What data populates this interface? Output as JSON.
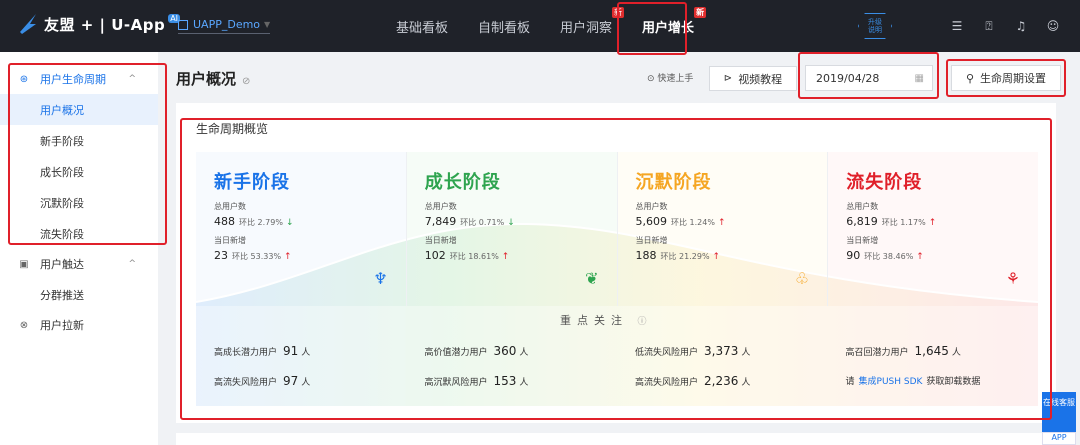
{
  "brand": {
    "name": "友盟 + | U-App",
    "badge": "AI"
  },
  "app_selector": {
    "value": "UAPP_Demo"
  },
  "nav": {
    "items": [
      {
        "label": "基础看板",
        "badge": ""
      },
      {
        "label": "自制看板",
        "badge": ""
      },
      {
        "label": "用户洞察",
        "badge": "新"
      },
      {
        "label": "用户增长",
        "badge": "新"
      }
    ]
  },
  "upgrade": {
    "line1": "升级",
    "line2": "说明"
  },
  "sidebar": {
    "group1": {
      "label": "用户生命周期",
      "icon": "lifecycle-icon"
    },
    "group1_items": [
      {
        "label": "用户概况"
      },
      {
        "label": "新手阶段"
      },
      {
        "label": "成长阶段"
      },
      {
        "label": "沉默阶段"
      },
      {
        "label": "流失阶段"
      }
    ],
    "group2": {
      "label": "用户触达",
      "icon": "reach-icon"
    },
    "group2_items": [
      {
        "label": "分群推送"
      }
    ],
    "group3": {
      "label": "用户拉新",
      "icon": "acquire-icon"
    }
  },
  "header": {
    "title": "用户概况",
    "quick_start": "快速上手",
    "video_btn": "视频教程",
    "date": "2019/04/28",
    "lifecycle_btn": "生命周期设置"
  },
  "panel": {
    "title": "生命周期概览",
    "focus_label": "重点关注",
    "stages": [
      {
        "name": "新手阶段",
        "color": "#1a73e8",
        "total_label": "总用户数",
        "total": "488",
        "total_hb": "环比 2.79%",
        "total_dir": "down",
        "new_label": "当日新增",
        "new": "23",
        "new_hb": "环比 53.33%",
        "new_dir": "up",
        "icon": "sprout-icon",
        "icon_char": "♆",
        "icon_color": "#1a73e8"
      },
      {
        "name": "成长阶段",
        "color": "#2ea44f",
        "total_label": "总用户数",
        "total": "7,849",
        "total_hb": "环比 0.71%",
        "total_dir": "down",
        "new_label": "当日新增",
        "new": "102",
        "new_hb": "环比 18.61%",
        "new_dir": "up",
        "icon": "plant-icon",
        "icon_char": "❦",
        "icon_color": "#2ea44f"
      },
      {
        "name": "沉默阶段",
        "color": "#f5a623",
        "total_label": "总用户数",
        "total": "5,609",
        "total_hb": "环比 1.24%",
        "total_dir": "up",
        "new_label": "当日新增",
        "new": "188",
        "new_hb": "环比 21.29%",
        "new_dir": "up",
        "icon": "wilting-icon",
        "icon_char": "♧",
        "icon_color": "#f5a623"
      },
      {
        "name": "流失阶段",
        "color": "#e0202a",
        "total_label": "总用户数",
        "total": "6,819",
        "total_hb": "环比 1.17%",
        "total_dir": "up",
        "new_label": "当日新增",
        "new": "90",
        "new_hb": "环比 38.46%",
        "new_dir": "up",
        "icon": "dead-plant-icon",
        "icon_char": "⚘",
        "icon_color": "#e0202a"
      }
    ],
    "focus": [
      {
        "r1_label": "高成长潜力用户",
        "r1_value": "91",
        "r1_unit": "人",
        "r2_label": "高流失风险用户",
        "r2_value": "97",
        "r2_unit": "人"
      },
      {
        "r1_label": "高价值潜力用户",
        "r1_value": "360",
        "r1_unit": "人",
        "r2_label": "高沉默风险用户",
        "r2_value": "153",
        "r2_unit": "人"
      },
      {
        "r1_label": "低流失风险用户",
        "r1_value": "3,373",
        "r1_unit": "人",
        "r2_label": "高流失风险用户",
        "r2_value": "2,236",
        "r2_unit": "人"
      },
      {
        "r1_label": "高召回潜力用户",
        "r1_value": "1,645",
        "r1_unit": "人",
        "r2_pre": "请",
        "r2_link": "集成PUSH SDK",
        "r2_post": "获取卸载数据"
      }
    ]
  },
  "float": {
    "online": "在线客服",
    "app": "APP"
  }
}
